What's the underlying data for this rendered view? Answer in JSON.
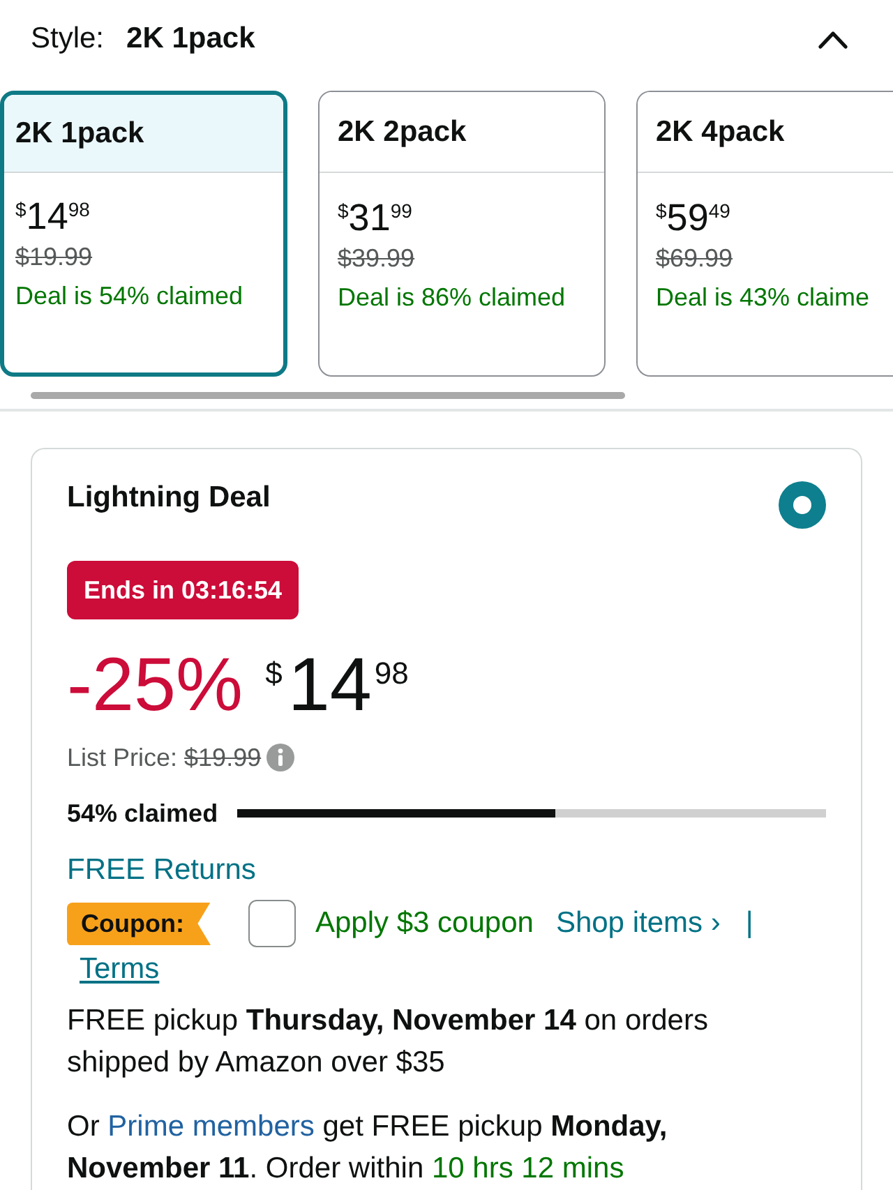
{
  "style_selector": {
    "label": "Style:",
    "value": "2K 1pack",
    "expanded": true
  },
  "style_options": [
    {
      "name": "2K 1pack",
      "price": {
        "symbol": "$",
        "whole": "14",
        "fraction": "98"
      },
      "list_price": "$19.99",
      "claimed": "Deal is 54% claimed",
      "selected": true
    },
    {
      "name": "2K 2pack",
      "price": {
        "symbol": "$",
        "whole": "31",
        "fraction": "99"
      },
      "list_price": "$39.99",
      "claimed": "Deal is 86% claimed",
      "selected": false
    },
    {
      "name": "2K 4pack",
      "price": {
        "symbol": "$",
        "whole": "59",
        "fraction": "49"
      },
      "list_price": "$69.99",
      "claimed": "Deal is 43% claime",
      "selected": false
    }
  ],
  "lightning_deal": {
    "title": "Lightning Deal",
    "selected": true,
    "timer": "Ends in 03:16:54",
    "discount": "-25%",
    "price": {
      "symbol": "$",
      "whole": "14",
      "fraction": "98"
    },
    "list_price_label": "List Price:",
    "list_price": "$19.99",
    "claimed_label": "54% claimed",
    "level": 0.54,
    "returns_link": "FREE Returns",
    "coupon": {
      "badge": "Coupon:",
      "checked": false,
      "label": "Apply $3 coupon",
      "shop_link": "Shop items ›",
      "separator": "|",
      "terms_link": "Terms"
    },
    "pickup_note": "FREE pickup **Thursday, November 14** on orders shipped by Amazon over $35",
    "prime_note": [
      {
        "kind": "text",
        "text": "Or "
      },
      {
        "kind": "link",
        "text": "Prime members"
      },
      {
        "kind": "text",
        "text": " get FREE pickup **Monday, November 11**. Order within "
      },
      {
        "kind": "countdown",
        "text": "10 hrs 12 mins"
      }
    ]
  }
}
